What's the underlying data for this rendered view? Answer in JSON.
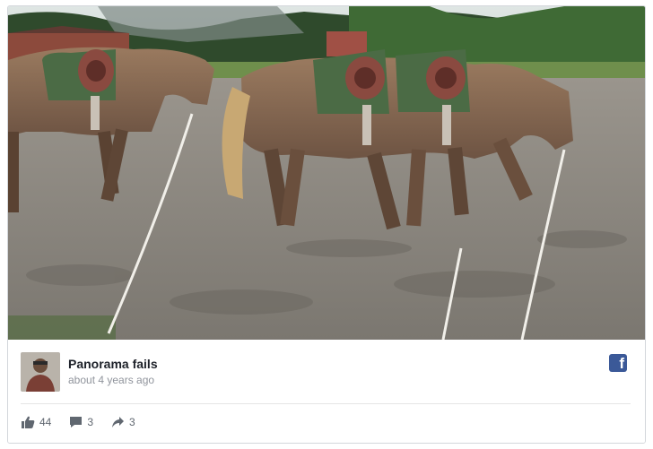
{
  "post": {
    "title": "Panorama fails",
    "time": "about 4 years ago"
  },
  "actions": {
    "likes": "44",
    "comments": "3",
    "shares": "3"
  },
  "icons": {
    "brand": "facebook-icon",
    "like": "thumbs-up-icon",
    "comment": "speech-bubble-icon",
    "share": "share-arrow-icon"
  },
  "colors": {
    "brand": "#3b5998",
    "muted_text": "#90949c",
    "action_text": "#606770"
  }
}
